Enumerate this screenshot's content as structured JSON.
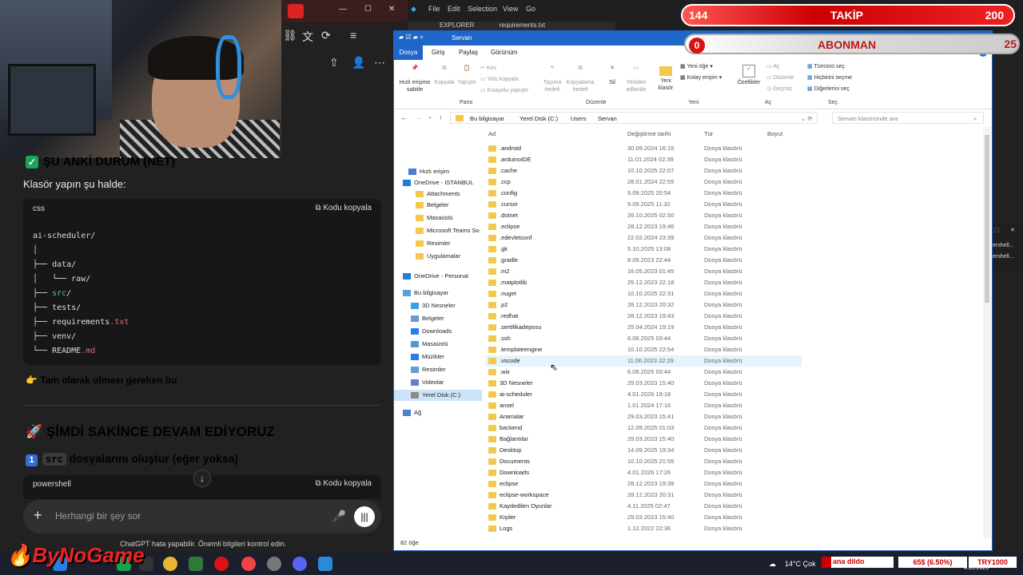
{
  "chat": {
    "status_heading": "ŞU ANKİ DURUM (NET)",
    "paragraph": "Klasör yapın şu halde:",
    "code1": {
      "lang": "css",
      "copy": "Kodu kopyala",
      "lines": [
        "ai-scheduler/",
        "│",
        "├── data/",
        "│   └── raw/",
        "├── src/",
        "├── tests/",
        "├── requirements.txt",
        "├── venv/",
        "└── README.md"
      ]
    },
    "pointer_text": "Tam olarak olması gereken bu",
    "heading2": "ŞİMDİ SAKİNCE DEVAM EDİYORUZ",
    "step_number": "1",
    "step_code": "src",
    "step_text": "dosyalarını oluştur (eğer yoksa)",
    "code2": {
      "lang": "powershell",
      "copy": "Kodu kopyala"
    },
    "input_placeholder": "Herhangi bir şey sor",
    "disclaimer": "ChatGPT hata yapabilir. Önemli bilgileri kontrol edin."
  },
  "vscode": {
    "menu": [
      "File",
      "Edit",
      "Selection",
      "View",
      "Go"
    ],
    "tab1": "EXPLORER",
    "tab2": "requirements.txt"
  },
  "explorer": {
    "title": "Servan",
    "tabs": [
      "Dosya",
      "Giriş",
      "Paylaş",
      "Görünüm"
    ],
    "ribbon": {
      "pin": "Hızlı erişime sabitle",
      "copy": "Kopyala",
      "paste": "Yapıştır",
      "cut": "Kes",
      "copy_path": "Yolu kopyala",
      "paste_shortcut": "Kısayolu yapıştır",
      "move": "Taşıma hedefi",
      "copy_to": "Kopyalama hedefi",
      "delete": "Sil",
      "rename": "Yeniden adlandır",
      "new_folder": "Yeni klasör",
      "new_item": "Yeni öğe",
      "easy_access": "Kolay erişim",
      "properties": "Özellikler",
      "open": "Aç",
      "edit": "Düzenle",
      "history": "Geçmiş",
      "select_all": "Tümünü seç",
      "select_none": "Hiçbirini seçme",
      "invert": "Diğerlerini seç",
      "groups": [
        "Pano",
        "Düzenle",
        "Yeni",
        "Aç",
        "Seç"
      ]
    },
    "path": [
      "Bu bilgisayar",
      "Yerel Disk (C:)",
      "Users",
      "Servan"
    ],
    "search_placeholder": "Servan klasöründe ara",
    "columns": [
      "Ad",
      "Değiştirme tarihi",
      "Tür",
      "Boyut"
    ],
    "nav": [
      "Hızlı erişim",
      "OneDrive - ISTANBUL",
      "Attachments",
      "Belgeler",
      "Masaüstü",
      "Microsoft Teams So",
      "Resimler",
      "Uygulamalar",
      "OneDrive - Personal",
      "Bu bilgisayar",
      "3D Nesneler",
      "Belgeler",
      "Downloads",
      "Masaüstü",
      "Müzikler",
      "Resimler",
      "Videolar",
      "Yerel Disk (C:)",
      "Ağ"
    ],
    "files": [
      {
        "n": ".android",
        "d": "30.09.2024 16:15"
      },
      {
        "n": ".arduinoIDE",
        "d": "11.01.2024 02:39"
      },
      {
        "n": ".cache",
        "d": "10.10.2025 22:07"
      },
      {
        "n": ".ccp",
        "d": "28.01.2024 22:55"
      },
      {
        "n": ".config",
        "d": "9.09.2025 20:54"
      },
      {
        "n": ".cursor",
        "d": "9.09.2025 11:32"
      },
      {
        "n": ".dotnet",
        "d": "26.10.2025 02:50"
      },
      {
        "n": ".eclipse",
        "d": "28.12.2023 19:46"
      },
      {
        "n": ".edevletconf",
        "d": "22.02.2024 23:39"
      },
      {
        "n": ".gk",
        "d": "5.10.2025 13:08"
      },
      {
        "n": ".gradle",
        "d": "8.09.2023 22:44"
      },
      {
        "n": ".m2",
        "d": "16.05.2023 01:45"
      },
      {
        "n": ".matplotlib",
        "d": "25.12.2023 22:18"
      },
      {
        "n": ".nuget",
        "d": "10.10.2025 22:31"
      },
      {
        "n": ".p2",
        "d": "28.12.2023 20:32"
      },
      {
        "n": ".redhat",
        "d": "28.12.2023 19:43"
      },
      {
        "n": ".sertifikadeposu",
        "d": "25.04.2024 19:19"
      },
      {
        "n": ".ssh",
        "d": "6.08.2025 03:44"
      },
      {
        "n": ".templateengine",
        "d": "10.10.2025 22:54"
      },
      {
        "n": ".vscode",
        "d": "11.06.2023 22:29"
      },
      {
        "n": ".wix",
        "d": "6.08.2025 03:44"
      },
      {
        "n": "3D Nesneler",
        "d": "29.03.2023 15:40"
      },
      {
        "n": "ai-scheduler",
        "d": "4.01.2026 19:18"
      },
      {
        "n": "ansel",
        "d": "1.01.2024 17:16"
      },
      {
        "n": "Aramalar",
        "d": "29.03.2023 15:41"
      },
      {
        "n": "backend",
        "d": "12.09.2025 01:03"
      },
      {
        "n": "Bağlantılar",
        "d": "29.03.2023 15:40"
      },
      {
        "n": "Desktop",
        "d": "14.09.2025 19:34"
      },
      {
        "n": "Documents",
        "d": "10.10.2025 21:55"
      },
      {
        "n": "Downloads",
        "d": "4.01.2026 17:26"
      },
      {
        "n": "eclipse",
        "d": "28.12.2023 19:39"
      },
      {
        "n": "eclipse-workspace",
        "d": "28.12.2023 20:31"
      },
      {
        "n": "Kaydedilen Oyunlar",
        "d": "4.11.2025 02:47"
      },
      {
        "n": "Kişiler",
        "d": "29.03.2023 15:40"
      },
      {
        "n": "Logs",
        "d": "1.12.2022 22:36"
      }
    ],
    "file_type": "Dosya klasörü",
    "status": "82 öğe"
  },
  "overlay": {
    "follow_count": "144",
    "follow_label": "TAKİP",
    "follow_goal": "200",
    "sub_count": "0",
    "sub_label": "ABONMAN",
    "sub_goal": "25"
  },
  "terminal_right": [
    "ershell...",
    "ershell..."
  ],
  "taskbar": {
    "weather": "14°C  Çok",
    "ticker1": "ana dildo",
    "ticker2": "65$ (6.50%)",
    "ticker3": "TRY1000",
    "date": "4.01.2026"
  },
  "brand": {
    "logo": "ByNoGame"
  }
}
